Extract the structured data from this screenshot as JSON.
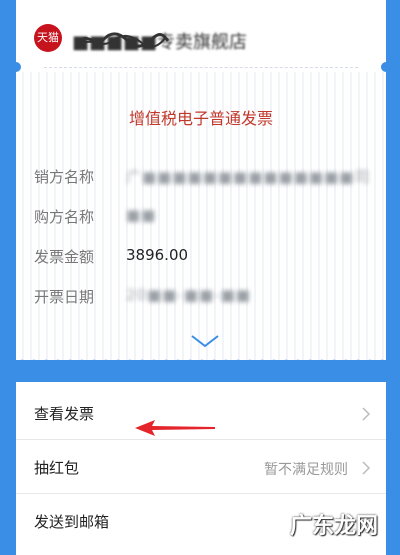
{
  "header": {
    "store_logo_text": "天猫",
    "store_name": "■■■■■专卖旗舰店"
  },
  "invoice": {
    "title": "增值税电子普通发票",
    "fields": [
      {
        "label": "销方名称",
        "value": "广■■■■■■■■■■■■■■司"
      },
      {
        "label": "购方名称",
        "value": "■■"
      },
      {
        "label": "发票金额",
        "value": "3896.00"
      },
      {
        "label": "开票日期",
        "value": "20■■-■■-■■"
      }
    ]
  },
  "actions": [
    {
      "label": "查看发票",
      "value": ""
    },
    {
      "label": "抽红包",
      "value": "暂不满足规则"
    },
    {
      "label": "发送到邮箱",
      "value": ""
    }
  ],
  "watermark": "广东龙网",
  "colors": {
    "background": "#3b8ee6",
    "title_red": "#c1392b",
    "logo_red": "#c6131e",
    "arrow_red": "#e4252c"
  }
}
